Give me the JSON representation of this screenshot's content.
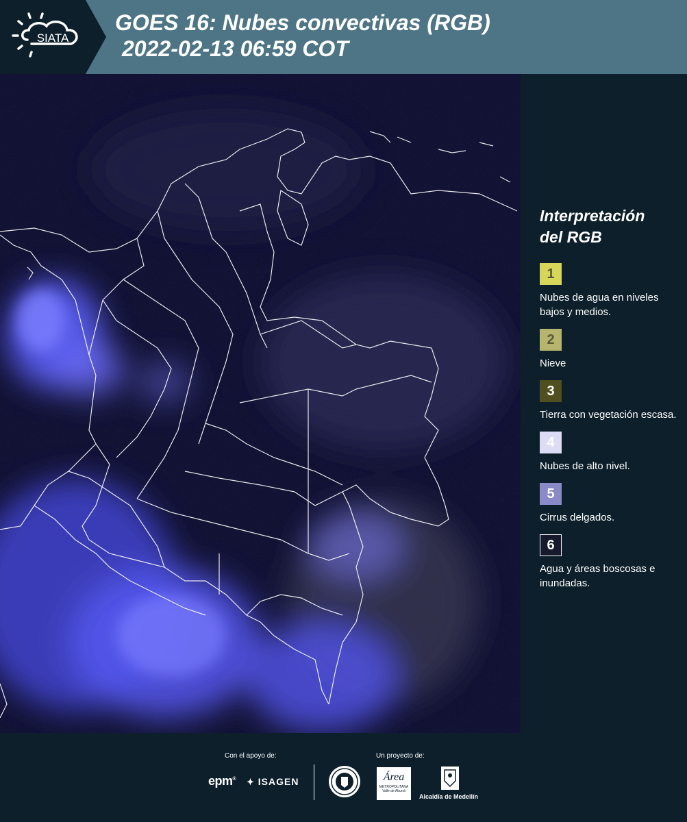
{
  "header": {
    "logo_text": "SIATA",
    "title_line1": "GOES 16: Nubes convectivas (RGB)",
    "title_line2": "2022-02-13 06:59 COT",
    "background_color": "#4d7585"
  },
  "legend": {
    "title_line1": "Interpretación",
    "title_line2": "del RGB",
    "items": [
      {
        "number": "1",
        "label": "Nubes de agua en niveles bajos y medios.",
        "color": "#d8d65a"
      },
      {
        "number": "2",
        "label": "Nieve",
        "color": "#b7b46e"
      },
      {
        "number": "3",
        "label": "Tierra con vegetación escasa.",
        "color": "#4f4f1f"
      },
      {
        "number": "4",
        "label": "Nubes de alto nivel.",
        "color": "#dcdcf4"
      },
      {
        "number": "5",
        "label": "Cirrus delgados.",
        "color": "#8a8ac8"
      },
      {
        "number": "6",
        "label": "Agua y áreas boscosas e inundadas.",
        "color": "#161a2c"
      }
    ]
  },
  "footer": {
    "support_label": "Con el apoyo de:",
    "project_label": "Un proyecto de:",
    "sponsors": [
      "epm",
      "ISAGEN"
    ],
    "partners": {
      "metropolitana_logo": "Área",
      "metropolitana_line1": "METROPOLITANA",
      "metropolitana_line2": "Valle de Aburrá",
      "alcaldia": "Alcaldía de Medellín"
    }
  },
  "map": {
    "background_color": "#121235",
    "border_color": "#ffffff",
    "cloud_color": "#5a5cf0"
  }
}
